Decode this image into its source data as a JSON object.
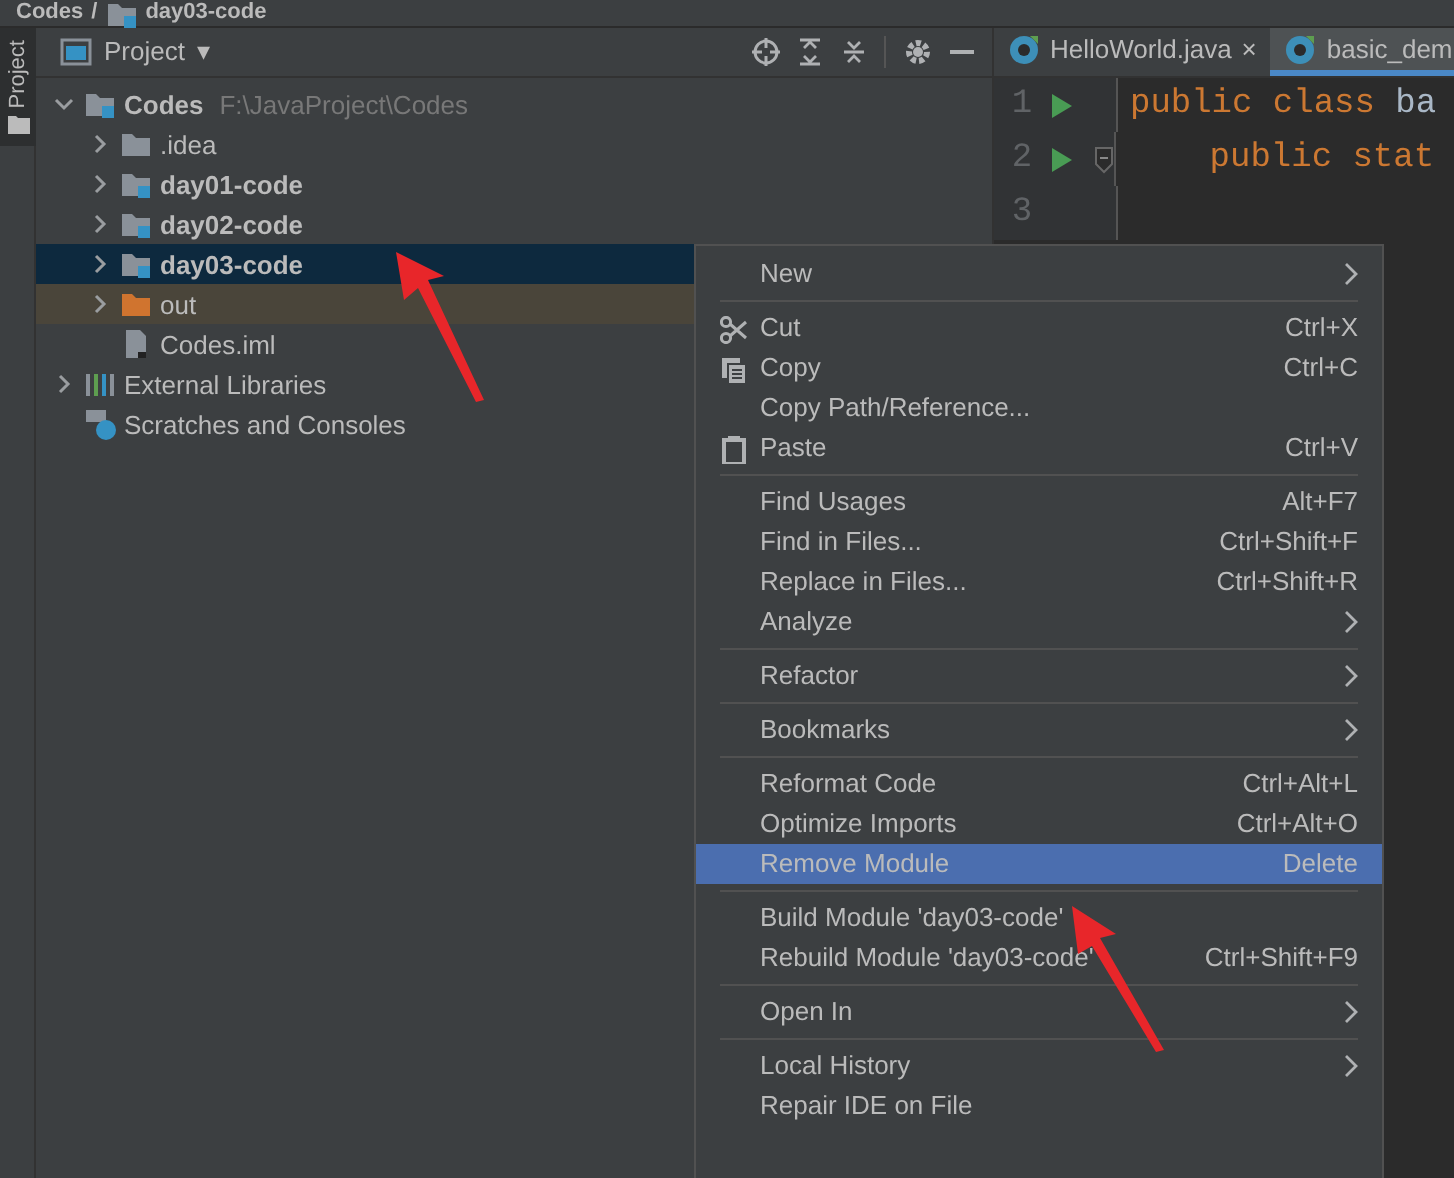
{
  "breadcrumb": [
    {
      "label": "Codes",
      "kind": "project"
    },
    {
      "label": "day03-code",
      "kind": "module",
      "separator": "/"
    }
  ],
  "tool_strip": [
    {
      "label": "Project",
      "selected": true
    }
  ],
  "project_panel": {
    "title": "Project",
    "caret": "▾",
    "tree": [
      {
        "label": "Codes",
        "path": "F:\\JavaProject\\Codes",
        "kind": "module",
        "expanded": true,
        "selected": false,
        "children": [
          {
            "label": ".idea",
            "kind": "folder",
            "expanded": false,
            "selected": false
          },
          {
            "label": "day01-code",
            "kind": "module",
            "expanded": false,
            "selected": false
          },
          {
            "label": "day02-code",
            "kind": "module",
            "expanded": false,
            "selected": false
          },
          {
            "label": "day03-code",
            "kind": "module",
            "expanded": false,
            "selected": true
          },
          {
            "label": "out",
            "kind": "excluded",
            "expanded": false,
            "selected": false
          },
          {
            "label": "Codes.iml",
            "kind": "file",
            "selected": false
          }
        ]
      },
      {
        "label": "External Libraries",
        "kind": "libraries",
        "expanded": false,
        "selected": false
      },
      {
        "label": "Scratches and Consoles",
        "kind": "scratches",
        "selected": false
      }
    ]
  },
  "editor": {
    "tabs": [
      {
        "label": "HelloWorld.java",
        "close": "×",
        "selected": false
      },
      {
        "label": "basic_dem",
        "selected": true
      }
    ],
    "lines": [
      {
        "number": "1",
        "run": true,
        "fold": false,
        "keyword": "public class",
        "rest": "ba"
      },
      {
        "number": "2",
        "run": true,
        "fold": true,
        "keyword": "    public stat"
      },
      {
        "number": "3",
        "run": false,
        "fold": false
      }
    ]
  },
  "context_menu": [
    {
      "kind": "item",
      "label": "New",
      "submenu": true,
      "selected": false
    },
    {
      "kind": "separator"
    },
    {
      "kind": "cut",
      "label": "Cut",
      "shortcut": "Ctrl+X",
      "selected": false
    },
    {
      "kind": "copy",
      "label": "Copy",
      "shortcut": "Ctrl+C",
      "selected": false
    },
    {
      "kind": "item",
      "label": "Copy Path/Reference...",
      "selected": false
    },
    {
      "kind": "paste",
      "label": "Paste",
      "shortcut": "Ctrl+V",
      "selected": false
    },
    {
      "kind": "separator"
    },
    {
      "kind": "item",
      "label": "Find Usages",
      "shortcut": "Alt+F7",
      "selected": false
    },
    {
      "kind": "item",
      "label": "Find in Files...",
      "shortcut": "Ctrl+Shift+F",
      "selected": false
    },
    {
      "kind": "item",
      "label": "Replace in Files...",
      "shortcut": "Ctrl+Shift+R",
      "selected": false
    },
    {
      "kind": "item",
      "label": "Analyze",
      "submenu": true,
      "selected": false
    },
    {
      "kind": "separator"
    },
    {
      "kind": "item",
      "label": "Refactor",
      "submenu": true,
      "selected": false
    },
    {
      "kind": "separator"
    },
    {
      "kind": "item",
      "label": "Bookmarks",
      "submenu": true,
      "selected": false
    },
    {
      "kind": "separator"
    },
    {
      "kind": "item",
      "label": "Reformat Code",
      "shortcut": "Ctrl+Alt+L",
      "selected": false
    },
    {
      "kind": "item",
      "label": "Optimize Imports",
      "shortcut": "Ctrl+Alt+O",
      "selected": false
    },
    {
      "kind": "item",
      "label": "Remove Module",
      "shortcut": "Delete",
      "selected": true
    },
    {
      "kind": "separator"
    },
    {
      "kind": "item",
      "label": "Build Module 'day03-code'",
      "selected": false
    },
    {
      "kind": "item",
      "label": "Rebuild Module 'day03-code'",
      "shortcut": "Ctrl+Shift+F9",
      "selected": false
    },
    {
      "kind": "separator"
    },
    {
      "kind": "item",
      "label": "Open In",
      "submenu": true,
      "selected": false
    },
    {
      "kind": "separator"
    },
    {
      "kind": "item",
      "label": "Local History",
      "submenu": true,
      "selected": false
    },
    {
      "kind": "item",
      "label": "Repair IDE on File",
      "selected": false
    }
  ]
}
